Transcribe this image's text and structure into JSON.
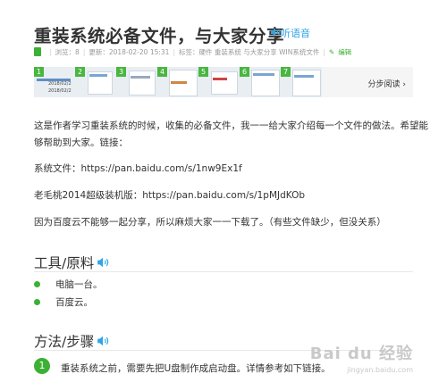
{
  "article": {
    "title": "重装系统必备文件，与大家分享",
    "listen_label": "听语音",
    "meta": {
      "views_label": "浏览：8",
      "updated_label": "更新：2018-02-20 15:31",
      "tags_label": "标签：硬件 重装系统 与大家分享 WIN系统文件",
      "edit_label": "编辑"
    },
    "step_read_label": "分步阅读",
    "thumb_numbers": [
      "1",
      "2",
      "3",
      "4",
      "5",
      "6",
      "7"
    ],
    "thumb_texts": {
      "t1a": "2018/02/2",
      "t1b": "2018/02/2"
    },
    "paragraphs": {
      "p1_line1": "这是作者学习重装系统的时候，收集的必备文件，我一一给大家介绍每一个文件的做法。希望能",
      "p1_line2": "够帮助到大家。链接：",
      "p2": "系统文件：https://pan.baidu.com/s/1nw9Ex1f",
      "p3": "老毛桃2014超级装机版：https://pan.baidu.com/s/1pMJdKOb",
      "p4": "因为百度云不能够一起分享，所以麻烦大家一一下载了。（有些文件缺少，但没关系）"
    },
    "tools_heading": "工具/原料",
    "tools": [
      "电脑一台。",
      "百度云。"
    ],
    "steps_heading": "方法/步骤",
    "step1_number": "1",
    "step1_text": "重装系统之前，需要先把U盘制作成启动盘。详情参考如下链接。",
    "watermark_brand": "Bai du 经验",
    "watermark_url": "jingyan.baidu.com"
  },
  "colors": {
    "accent_green": "#3cb034",
    "accent_blue": "#2fa5e6"
  }
}
